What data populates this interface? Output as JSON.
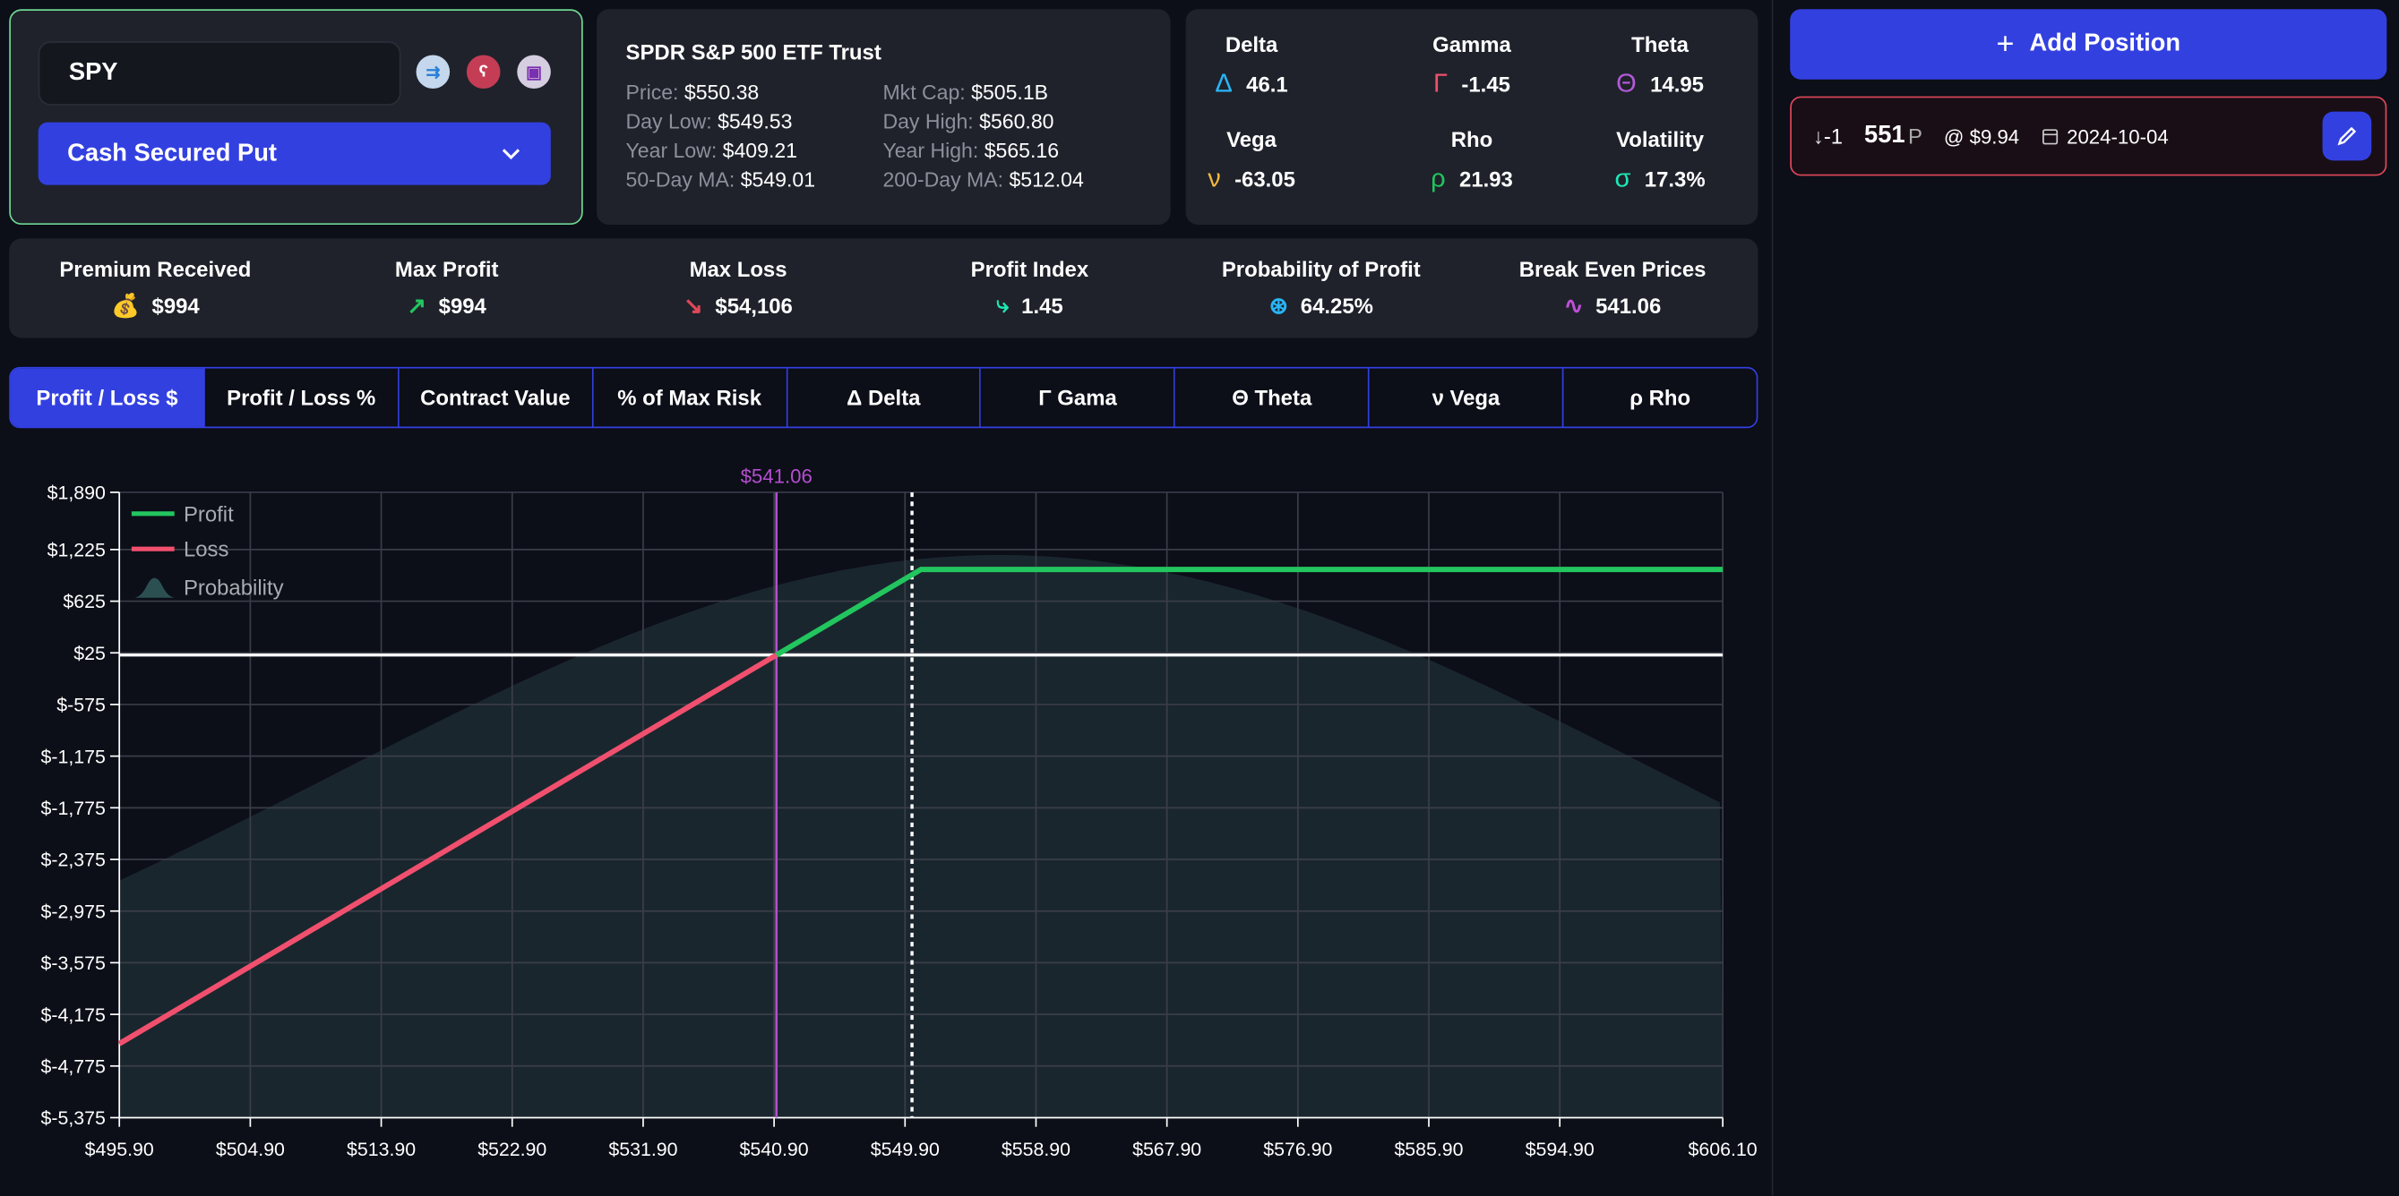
{
  "symbol_panel": {
    "symbol": "SPY",
    "strategy": "Cash Secured Put",
    "icons": [
      "broker-transfer-icon",
      "bear-icon",
      "screen-icon"
    ]
  },
  "quote": {
    "name": "SPDR S&P 500 ETF Trust",
    "rows": [
      {
        "label": "Price:",
        "value": "$550.38"
      },
      {
        "label": "Mkt Cap:",
        "value": "$505.1B"
      },
      {
        "label": "Day Low:",
        "value": "$549.53"
      },
      {
        "label": "Day High:",
        "value": "$560.80"
      },
      {
        "label": "Year Low:",
        "value": "$409.21"
      },
      {
        "label": "Year High:",
        "value": "$565.16"
      },
      {
        "label": "50-Day MA:",
        "value": "$549.01"
      },
      {
        "label": "200-Day MA:",
        "value": "$512.04"
      }
    ]
  },
  "greeks": [
    {
      "label": "Delta",
      "symbol": "Δ",
      "value": "46.1",
      "color": "#29b6f6"
    },
    {
      "label": "Gamma",
      "symbol": "Γ",
      "value": "-1.45",
      "color": "#f0506e"
    },
    {
      "label": "Theta",
      "symbol": "Θ",
      "value": "14.95",
      "color": "#b35ad8"
    },
    {
      "label": "Vega",
      "symbol": "ν",
      "value": "-63.05",
      "color": "#f5b83d"
    },
    {
      "label": "Rho",
      "symbol": "ρ",
      "value": "21.93",
      "color": "#22c55e"
    },
    {
      "label": "Volatility",
      "symbol": "σ",
      "value": "17.3%",
      "color": "#1de9b6"
    }
  ],
  "add_position_label": "Add Position",
  "position": {
    "direction": "↓",
    "qty": "-1",
    "strike": "551",
    "type": "P",
    "price": "@ $9.94",
    "expiry": "2024-10-04"
  },
  "stats": [
    {
      "label": "Premium Received",
      "value": "$994",
      "icon": "money-bag-icon",
      "color": "#f5d63d"
    },
    {
      "label": "Max Profit",
      "value": "$994",
      "icon": "chart-up-icon",
      "color": "#22c55e"
    },
    {
      "label": "Max Loss",
      "value": "$54,106",
      "icon": "chart-down-icon",
      "color": "#e0485a"
    },
    {
      "label": "Profit Index",
      "value": "1.45",
      "icon": "route-icon",
      "color": "#1de9b6"
    },
    {
      "label": "Probability of Profit",
      "value": "64.25%",
      "icon": "search-dollar-icon",
      "color": "#29b6f6"
    },
    {
      "label": "Break Even Prices",
      "value": "541.06",
      "icon": "pulse-icon",
      "color": "#c04fd8"
    }
  ],
  "tabs": [
    {
      "label": "Profit / Loss $",
      "active": true
    },
    {
      "label": "Profit / Loss %"
    },
    {
      "label": "Contract Value"
    },
    {
      "label": "% of Max Risk"
    },
    {
      "label": "Δ Delta"
    },
    {
      "label": "Γ Gama"
    },
    {
      "label": "Θ Theta"
    },
    {
      "label": "ν Vega"
    },
    {
      "label": "ρ Rho"
    }
  ],
  "chart_data": {
    "type": "line",
    "xlim": [
      495.9,
      606.1
    ],
    "ylim": [
      -5375,
      1890
    ],
    "x_ticks": [
      "$495.90",
      "$504.90",
      "$513.90",
      "$522.90",
      "$531.90",
      "$540.90",
      "$549.90",
      "$558.90",
      "$567.90",
      "$576.90",
      "$585.90",
      "$594.90",
      "$606.10"
    ],
    "x_tick_values": [
      495.9,
      504.9,
      513.9,
      522.9,
      531.9,
      540.9,
      549.9,
      558.9,
      567.9,
      576.9,
      585.9,
      594.9,
      606.1
    ],
    "y_ticks": [
      "$1,890",
      "$1,225",
      "$625",
      "$25",
      "$-575",
      "$-1,175",
      "$-1,775",
      "$-2,375",
      "$-2,975",
      "$-3,575",
      "$-4,175",
      "$-4,775",
      "$-5,375"
    ],
    "y_tick_values": [
      1890,
      1225,
      625,
      25,
      -575,
      -1175,
      -1775,
      -2375,
      -2975,
      -3575,
      -4175,
      -4775,
      -5375
    ],
    "grid": true,
    "legend": {
      "placement": "top-left",
      "entries": [
        "Profit",
        "Loss",
        "Probability"
      ]
    },
    "series": [
      {
        "name": "Profit",
        "color": "#22c55e",
        "points": [
          [
            541.06,
            0
          ],
          [
            551,
            994
          ],
          [
            606.1,
            994
          ]
        ]
      },
      {
        "name": "Loss",
        "color": "#f0506e",
        "points": [
          [
            495.9,
            -4516
          ],
          [
            541.06,
            0
          ]
        ]
      }
    ],
    "break_even": {
      "x": 541.06,
      "label": "$541.06",
      "color": "#b54fd0"
    },
    "current_price": 550.38,
    "probability_color": "#1a262e"
  }
}
